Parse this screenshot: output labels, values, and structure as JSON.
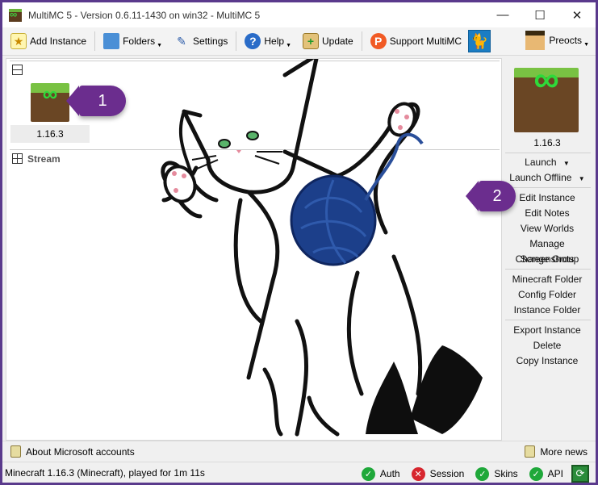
{
  "window": {
    "title": "MultiMC 5 - Version 0.6.11-1430 on win32 - MultiMC 5",
    "minimize": "—",
    "maximize": "☐",
    "close": "✕"
  },
  "toolbar": {
    "add_instance": "Add Instance",
    "folders": "Folders",
    "settings": "Settings",
    "help": "Help",
    "update": "Update",
    "support": "Support MultiMC",
    "account": "Preocts"
  },
  "groups": {
    "default_group": {
      "name": ""
    },
    "stream_group": {
      "name": "Stream"
    }
  },
  "instance": {
    "label": "1.16.3"
  },
  "right_panel": {
    "instance_name": "1.16.3",
    "launch": "Launch",
    "launch_offline": "Launch Offline",
    "edit_instance": "Edit Instance",
    "edit_notes": "Edit Notes",
    "view_worlds": "View Worlds",
    "manage_screenshots": "Manage Screenshots",
    "change_group": "Change Group",
    "minecraft_folder": "Minecraft Folder",
    "config_folder": "Config Folder",
    "instance_folder": "Instance Folder",
    "export_instance": "Export Instance",
    "delete": "Delete",
    "copy_instance": "Copy Instance"
  },
  "news": {
    "about_accounts": "About Microsoft accounts",
    "more_news": "More news"
  },
  "status": {
    "text": "Minecraft 1.16.3 (Minecraft), played for 1m 11s",
    "auth": "Auth",
    "session": "Session",
    "skins": "Skins",
    "api": "API"
  },
  "callouts": {
    "one": "1",
    "two": "2"
  },
  "colors": {
    "callout": "#6b2d8e",
    "ok": "#1fa83a",
    "error": "#d7262e"
  }
}
